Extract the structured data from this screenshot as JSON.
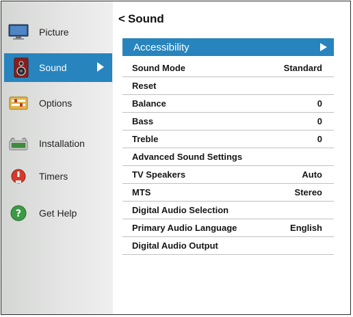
{
  "sidebar": {
    "items": [
      {
        "label": "Picture",
        "icon": "tv-monitor-icon"
      },
      {
        "label": "Sound",
        "icon": "speaker-icon"
      },
      {
        "label": "Options",
        "icon": "options-icon"
      },
      {
        "label": "Installation",
        "icon": "installation-icon"
      },
      {
        "label": "Timers",
        "icon": "timer-icon"
      },
      {
        "label": "Get Help",
        "icon": "help-icon"
      }
    ]
  },
  "header": {
    "back_glyph": "<",
    "title": "Sound"
  },
  "menu": {
    "highlighted": "Accessibility",
    "rows": [
      {
        "label": "Sound Mode",
        "value": "Standard"
      },
      {
        "label": "Reset",
        "value": ""
      },
      {
        "label": "Balance",
        "value": "0"
      },
      {
        "label": "Bass",
        "value": "0"
      },
      {
        "label": "Treble",
        "value": "0"
      },
      {
        "label": "Advanced Sound Settings",
        "value": ""
      },
      {
        "label": "TV Speakers",
        "value": "Auto"
      },
      {
        "label": "MTS",
        "value": "Stereo"
      },
      {
        "label": "Digital Audio Selection",
        "value": ""
      },
      {
        "label": "Primary Audio Language",
        "value": "English"
      },
      {
        "label": "Digital Audio Output",
        "value": ""
      }
    ]
  },
  "colors": {
    "accent": "#2784bd",
    "sidebar": "#dcdddc",
    "divider": "#bfbfbf"
  }
}
